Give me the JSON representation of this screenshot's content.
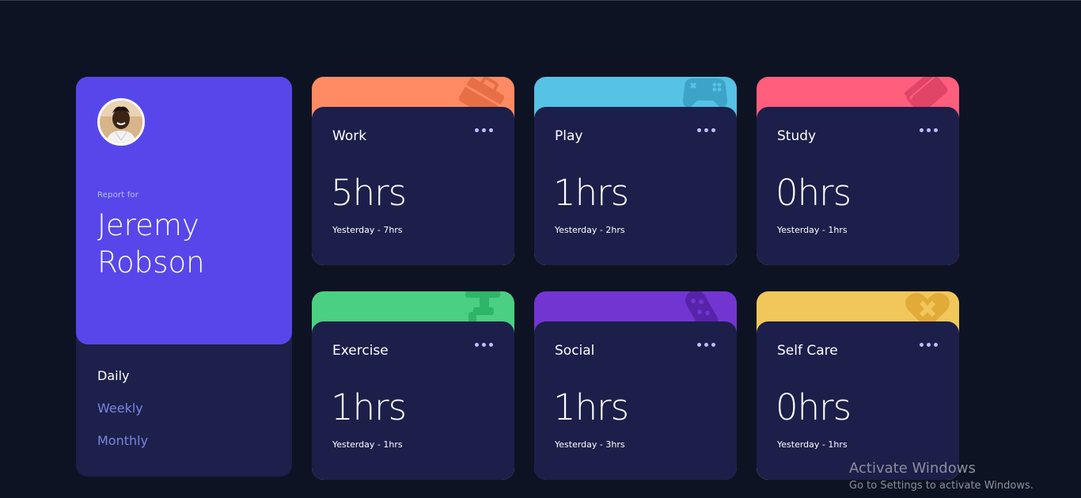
{
  "profile": {
    "report_for": "Report for",
    "name": "Jeremy Robson",
    "periods": [
      {
        "label": "Daily",
        "active": true
      },
      {
        "label": "Weekly",
        "active": false
      },
      {
        "label": "Monthly",
        "active": false
      }
    ]
  },
  "activities": [
    {
      "title": "Work",
      "hours": "5hrs",
      "previous": "Yesterday - 7hrs",
      "color": "#ff8b64",
      "icon": "briefcase-icon"
    },
    {
      "title": "Play",
      "hours": "1hrs",
      "previous": "Yesterday - 2hrs",
      "color": "#55c2e6",
      "icon": "gamepad-icon"
    },
    {
      "title": "Study",
      "hours": "0hrs",
      "previous": "Yesterday - 1hrs",
      "color": "#ff5e7d",
      "icon": "book-icon"
    },
    {
      "title": "Exercise",
      "hours": "1hrs",
      "previous": "Yesterday - 1hrs",
      "color": "#4bcf82",
      "icon": "running-icon"
    },
    {
      "title": "Social",
      "hours": "1hrs",
      "previous": "Yesterday - 3hrs",
      "color": "#7335d2",
      "icon": "social-icon"
    },
    {
      "title": "Self Care",
      "hours": "0hrs",
      "previous": "Yesterday - 1hrs",
      "color": "#f1c75b",
      "icon": "heart-icon"
    }
  ],
  "watermark": {
    "title": "Activate Windows",
    "subtitle": "Go to Settings to activate Windows."
  }
}
